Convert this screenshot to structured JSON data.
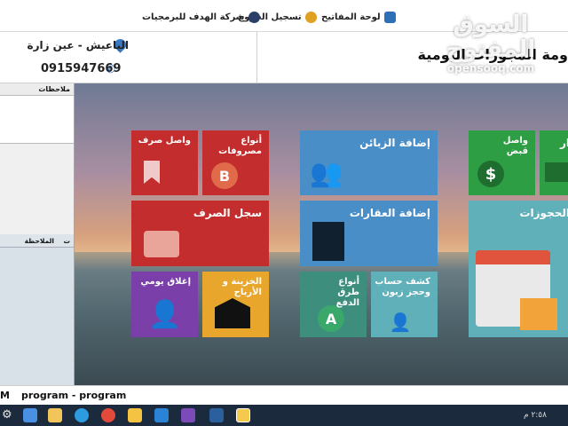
{
  "toolbar": {
    "items": [
      {
        "label": "لوحة المفاتيح",
        "icon": "keyboard-icon"
      },
      {
        "label": "تسجيل الخروج",
        "icon": "logout-lock-icon"
      },
      {
        "label": "شركة الهدف للبرمجيات",
        "icon": "company-logo-icon"
      }
    ]
  },
  "watermark": {
    "main": "السوق المفتوح",
    "sub": "opensooq.com"
  },
  "header": {
    "location": "الباعيش - عين زارة",
    "phone": "0915947669",
    "title": "ومة المجوزات اليومية"
  },
  "left_panel": {
    "notes_header": "ملاحظات",
    "grid_columns": [
      "ت",
      "الملاحظة"
    ]
  },
  "tiles": [
    {
      "id": "receipt-voucher",
      "label": "واصل قبض",
      "color": "#2e9e44"
    },
    {
      "id": "add-customers",
      "label": "إضافة الزبائن",
      "color": "#4a8ec8"
    },
    {
      "id": "expense-types",
      "label": "أنواع مصروفات",
      "color": "#c42d2d"
    },
    {
      "id": "payment-voucher",
      "label": "واصل صرف",
      "color": "#c42d2d"
    },
    {
      "id": "add-properties",
      "label": "إضافة العقارات",
      "color": "#4a8ec8"
    },
    {
      "id": "bookings",
      "label": "الحجوزات",
      "color": "#5fb0b9"
    },
    {
      "id": "expense-log",
      "label": "سجل الصرف",
      "color": "#c42d2d"
    },
    {
      "id": "account-statement",
      "label": "كشف حساب وحجز زبون",
      "color": "#5fb0b9"
    },
    {
      "id": "payment-methods",
      "label": "أنواع طرق الدفع",
      "color": "#3e8e7e"
    },
    {
      "id": "treasury-profits",
      "label": "الخزينة و الأرباح",
      "color": "#e8a62c"
    },
    {
      "id": "daily-close",
      "label": "إغلاق يومي",
      "color": "#7a3fa8"
    },
    {
      "id": "partial-green",
      "label": "ار",
      "color": "#2e9e44"
    }
  ],
  "status_bar": {
    "left": "M",
    "text": "program - program"
  },
  "taskbar": {
    "tray_time": "٢:٥٨ م",
    "apps": [
      "start-icon",
      "search-icon",
      "file-explorer-icon",
      "edge-icon",
      "chrome-icon",
      "paint-icon",
      "vscode-icon",
      "visual-studio-icon",
      "app-l-icon",
      "folder-icon"
    ]
  }
}
